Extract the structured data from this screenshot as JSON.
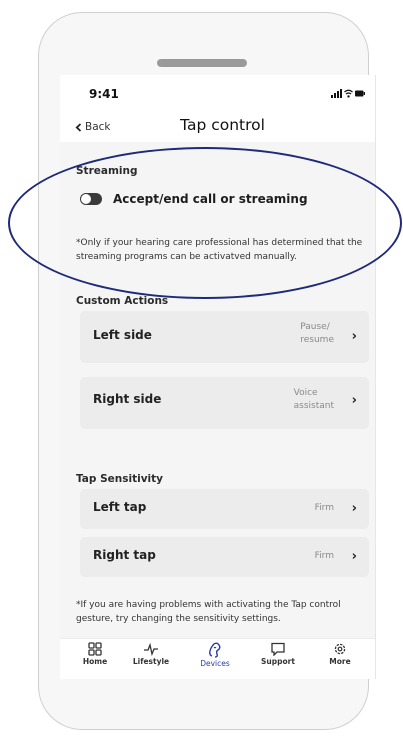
{
  "status_bar": {
    "time": "9:41"
  },
  "nav": {
    "back_label": "Back",
    "title": "Tap control"
  },
  "streaming": {
    "section_label": "Streaming",
    "toggle_label": "Accept/end call or streaming",
    "toggle_on": false,
    "note": "*Only if your hearing care professional has determined that the streaming programs can be activatved manually."
  },
  "custom_actions": {
    "section_label": "Custom Actions",
    "items": [
      {
        "label": "Left side",
        "value_line1": "Pause/",
        "value_line2": "resume"
      },
      {
        "label": "Right side",
        "value_line1": "Voice",
        "value_line2": "assistant"
      }
    ]
  },
  "tap_sensitivity": {
    "section_label": "Tap Sensitivity",
    "items": [
      {
        "label": "Left tap",
        "value": "Firm"
      },
      {
        "label": "Right tap",
        "value": "Firm"
      }
    ],
    "note": "*If you are having problems with activating the Tap control gesture, try changing the sensitivity settings."
  },
  "tab_bar": {
    "items": [
      {
        "label": "Home",
        "icon": "grid-icon"
      },
      {
        "label": "Lifestyle",
        "icon": "pulse-icon"
      },
      {
        "label": "Devices",
        "icon": "hearing-aid-icon"
      },
      {
        "label": "Support",
        "icon": "chat-bubble-icon"
      },
      {
        "label": "More",
        "icon": "gear-icon"
      }
    ],
    "active": "Devices"
  },
  "colors": {
    "accent": "#2a3caa",
    "annotation_oval": "#1f2a78",
    "card_background": "#ececec",
    "toggle_off": "#3a3a3a"
  }
}
